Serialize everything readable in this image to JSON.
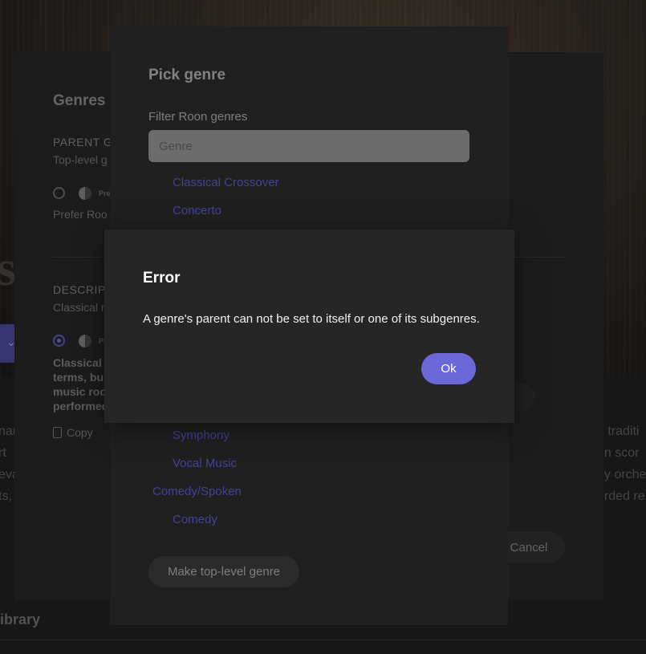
{
  "background": {
    "hero_big_text": "si",
    "hero_button_icon": "chevron-down-icon",
    "right_text_lines": [
      "n traditi",
      "en scor",
      "ny orche",
      "orded re"
    ],
    "left_text_lines": [
      "nar",
      "rt",
      "eva",
      "ts,"
    ],
    "library_label": "ibrary"
  },
  "editor": {
    "title": "Genres e",
    "parent_label": "PARENT G",
    "parent_value": "Top-level g",
    "prefer_label": "Prefer Roo",
    "prefer_tiny": "Pre",
    "description_label": "DESCRIPT",
    "description_value": "Classical r",
    "description_body": [
      "Classical r",
      "terms, bu",
      "music roo",
      "performed"
    ],
    "copy_label": "Copy",
    "cancel_label": "Cancel"
  },
  "pick_genre": {
    "title": "Pick genre",
    "filter_label": "Filter Roon genres",
    "filter_placeholder": "Genre",
    "items_top": [
      {
        "label": "Classical Crossover",
        "level": "sub"
      },
      {
        "label": "Concerto",
        "level": "sub"
      }
    ],
    "items_bottom": [
      {
        "label": "Symphony",
        "level": "sub"
      },
      {
        "label": "Vocal Music",
        "level": "sub"
      },
      {
        "label": "Comedy/Spoken",
        "level": "top"
      },
      {
        "label": "Comedy",
        "level": "sub"
      }
    ],
    "make_top_level_label": "Make top-level genre"
  },
  "error_dialog": {
    "title": "Error",
    "message": "A genre's parent can not be set to itself or one of its subgenres.",
    "ok_label": "Ok",
    "accent_color": "#6a68d9"
  }
}
